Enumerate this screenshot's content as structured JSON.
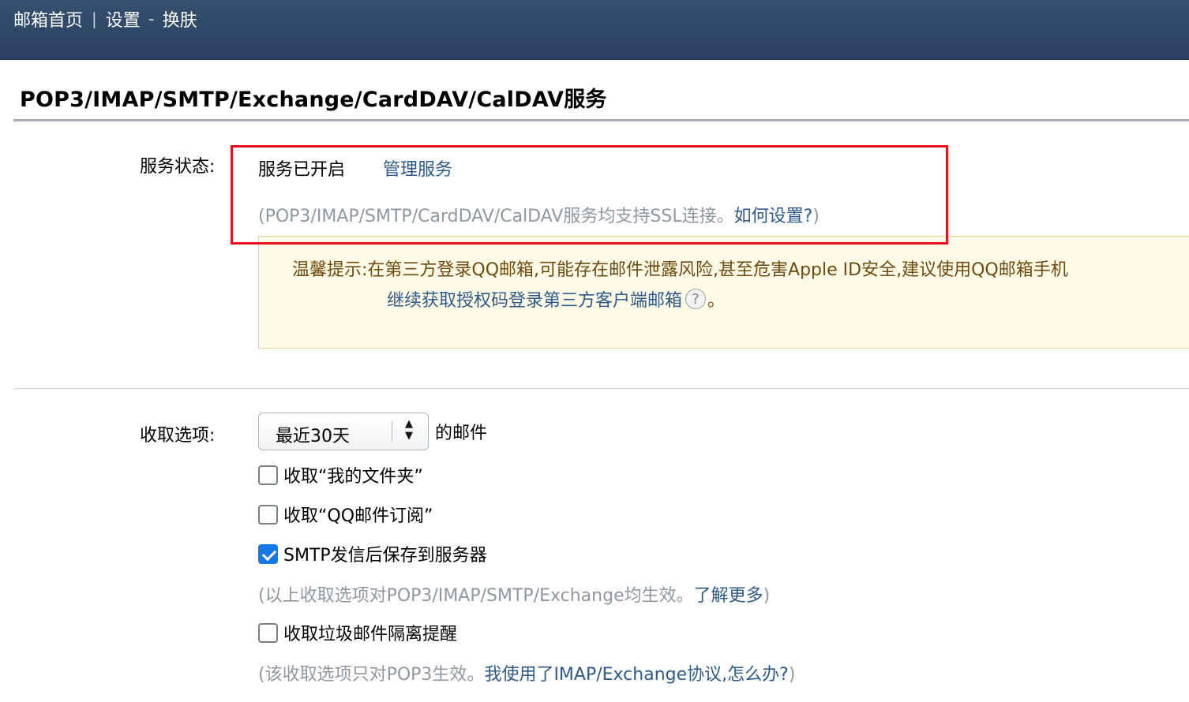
{
  "topbar": {
    "home_link": "邮箱首页",
    "separator": "|",
    "settings_link": "设置",
    "dash": "-",
    "current": "换肤"
  },
  "section": {
    "title": "POP3/IMAP/SMTP/Exchange/CardDAV/CalDAV服务"
  },
  "service": {
    "label": "服务状态:",
    "status": "服务已开启",
    "manage_link": "管理服务",
    "ssl_prefix": "(POP3/IMAP/SMTP/CardDAV/CalDAV服务均支持SSL连接。",
    "ssl_link": "如何设置?",
    "ssl_suffix": ")"
  },
  "tip": {
    "line1": "温馨提示:在第三方登录QQ邮箱,可能存在邮件泄露风险,甚至危害Apple ID安全,建议使用QQ邮箱手机",
    "link": "继续获取授权码登录第三方客户端邮箱",
    "help_icon": "?",
    "period": "。"
  },
  "receive": {
    "label": "收取选项:",
    "select_value": "最近30天",
    "select_suffix": "的邮件",
    "options": [
      {
        "label": "收取“我的文件夹”",
        "checked": false
      },
      {
        "label": "收取“QQ邮件订阅”",
        "checked": false
      },
      {
        "label": "SMTP发信后保存到服务器",
        "checked": true
      }
    ],
    "note1_prefix": "(以上收取选项对POP3/IMAP/SMTP/Exchange均生效。",
    "note1_link": "了解更多",
    "note1_suffix": ")",
    "spam_option": {
      "label": "收取垃圾邮件隔离提醒",
      "checked": false
    },
    "note2_prefix": "(该收取选项只对POP3生效。",
    "note2_link": "我使用了IMAP/Exchange协议,怎么办?",
    "note2_suffix": ")"
  },
  "colors": {
    "topbar": "#2f4766",
    "link": "#2d5a8b",
    "highlight": "#e60f1b",
    "tip_bg": "#fffbe6",
    "checkbox_checked": "#1677e6"
  }
}
